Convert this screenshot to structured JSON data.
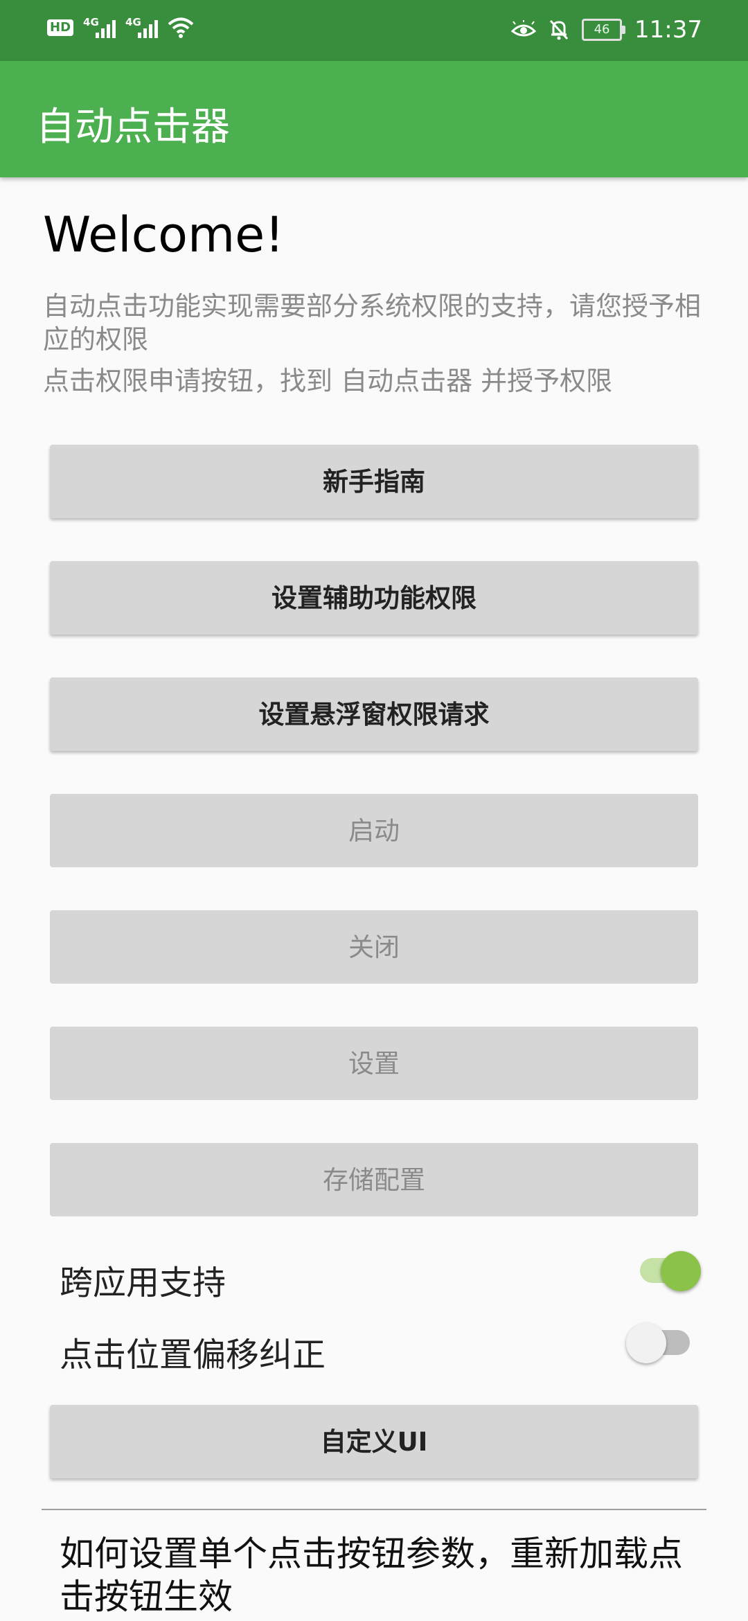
{
  "status": {
    "time": "11:37",
    "battery": "46",
    "network1": "4G",
    "network2": "4G",
    "hd": "HD"
  },
  "app": {
    "title": "自动点击器"
  },
  "main": {
    "welcome": "Welcome!",
    "desc": "自动点击功能实现需要部分系统权限的支持，请您授予相应的权限",
    "desc2": "点击权限申请按钮，找到 自动点击器 并授予权限"
  },
  "buttons": {
    "guide": "新手指南",
    "accessibility": "设置辅助功能权限",
    "overlay": "设置悬浮窗权限请求",
    "start": "启动",
    "stop": "关闭",
    "settings": "设置",
    "save_config": "存储配置",
    "custom_ui": "自定义UI"
  },
  "toggles": {
    "cross_app": {
      "label": "跨应用支持",
      "on": true
    },
    "offset_fix": {
      "label": "点击位置偏移纠正",
      "on": false
    }
  },
  "help": {
    "text": "如何设置单个点击按钮参数，重新加载点击按钮生效"
  }
}
